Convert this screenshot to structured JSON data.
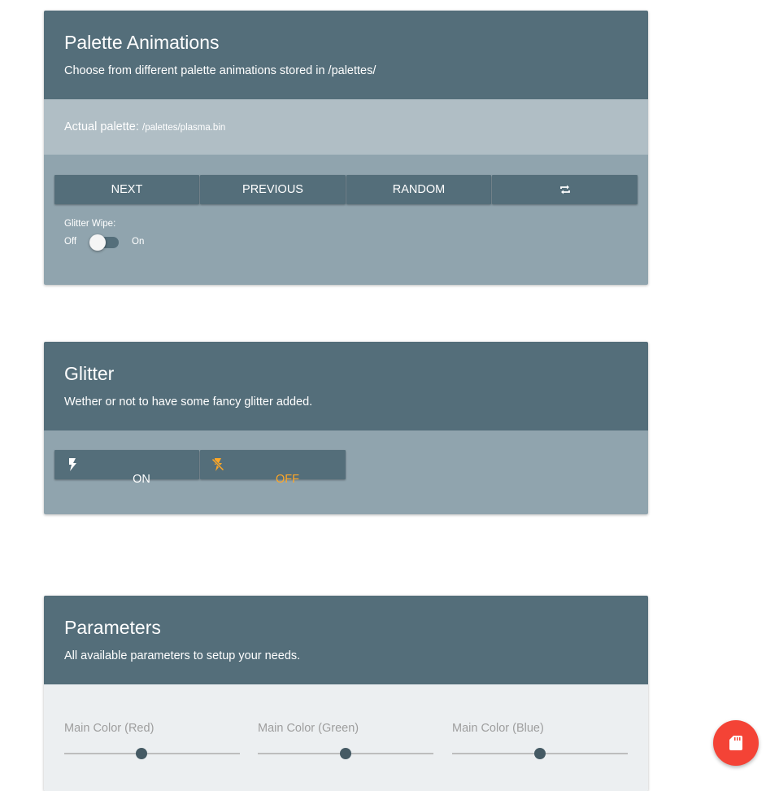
{
  "palette": {
    "title": "Palette Animations",
    "subtitle": "Choose from different palette animations stored in /palettes/",
    "actual_label": "Actual palette:",
    "actual_value": "/palettes/plasma.bin",
    "buttons": {
      "next": "NEXT",
      "previous": "PREVIOUS",
      "random": "RANDOM",
      "repeat_icon": "repeat-icon"
    },
    "glitter_wipe": {
      "label": "Glitter Wipe:",
      "off": "Off",
      "on": "On",
      "state": false
    }
  },
  "glitter": {
    "title": "Glitter",
    "subtitle": "Wether or not to have some fancy glitter added.",
    "on_label": "ON",
    "off_label": "OFF",
    "selected": "off",
    "active_color": "#ffa726"
  },
  "parameters": {
    "title": "Parameters",
    "subtitle": "All available parameters to setup your needs.",
    "sliders": [
      {
        "label": "Main Color (Red)",
        "value": 0.44
      },
      {
        "label": "Main Color (Green)",
        "value": 0.5
      },
      {
        "label": "Main Color (Blue)",
        "value": 0.5
      }
    ]
  },
  "fab": {
    "icon": "sd-card-icon",
    "color": "#f44336"
  }
}
